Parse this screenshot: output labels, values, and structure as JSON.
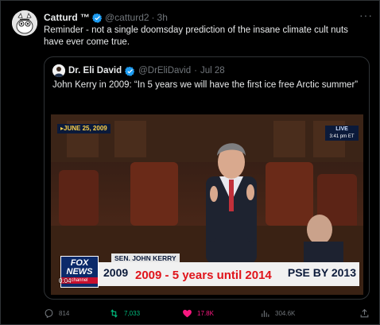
{
  "tweet": {
    "author_name": "Catturd ™",
    "handle": "@catturd2",
    "separator": "·",
    "time": "3h",
    "more_label": "···",
    "text": "Reminder - not a single doomsday prediction of the insane climate cult nuts have ever come true."
  },
  "quote": {
    "author_name": "Dr. Eli David",
    "handle": "@DrEliDavid",
    "separator": "·",
    "time": "Jul 28",
    "text": "John Kerry in 2009: “In 5 years we will have the first ice free Arctic summer”",
    "video": {
      "date_banner": "▸JUNE 25, 2009",
      "live_label": "LIVE",
      "live_time": "3:41 pm ET",
      "senator_label": "SEN. JOHN KERRY",
      "lower_left": "2009",
      "lower_right": "PSE BY 2013",
      "overlay_text": "2009 - 5 years until 2014",
      "network": "FOX NEWS",
      "network_sub": "channel",
      "timer": "0:04"
    }
  },
  "actions": {
    "replies": "814",
    "retweets": "7,033",
    "likes": "17.8K",
    "views": "304.6K"
  },
  "colors": {
    "background": "#000000",
    "text": "#e7e9ea",
    "secondary": "#71767b",
    "verified": "#1d9bf0",
    "retweet": "#00ba7c",
    "like": "#f91880"
  }
}
